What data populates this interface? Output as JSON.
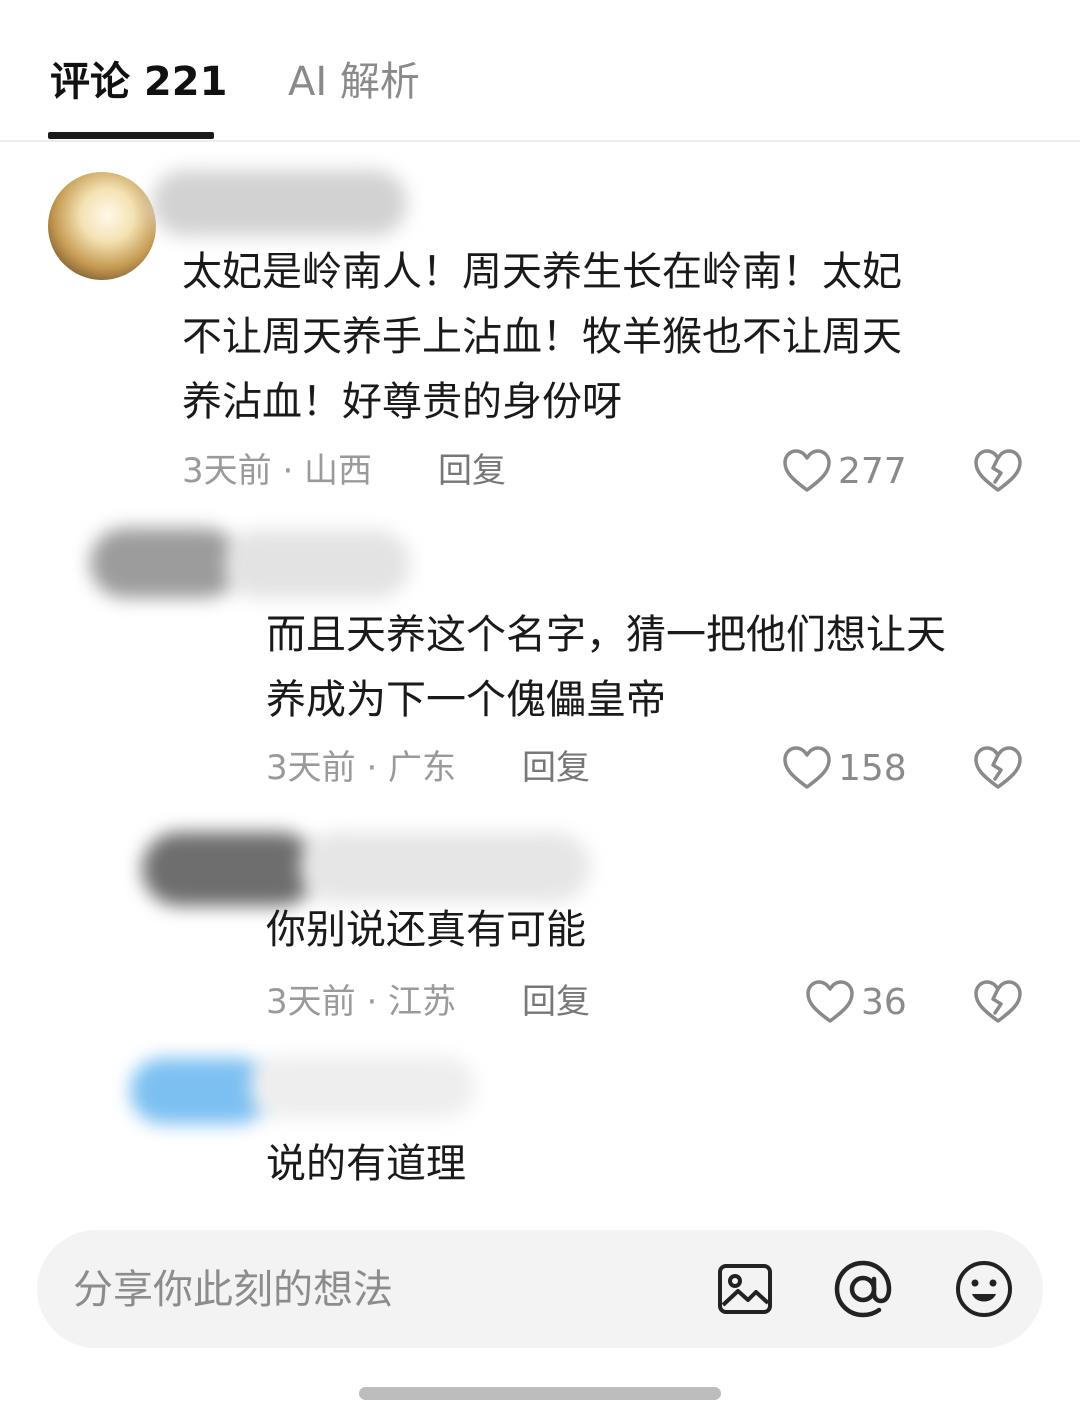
{
  "tabs": [
    {
      "label": "评论 221",
      "active": true
    },
    {
      "label": "AI 解析",
      "active": false
    }
  ],
  "comments": [
    {
      "text_lines": [
        "太妃是岭南人！周天养生长在岭南！太妃",
        "不让周天养手上沾血！牧羊猴也不让周天",
        "养沾血！好尊贵的身份呀"
      ],
      "meta": "3天前 · 山西",
      "reply": "回复",
      "likes": "277"
    },
    {
      "text_lines": [
        "而且天养这个名字，猜一把他们想让天",
        "养成为下一个傀儡皇帝"
      ],
      "meta": "3天前 · 广东",
      "reply": "回复",
      "likes": "158"
    },
    {
      "text_lines": [
        "你别说还真有可能"
      ],
      "meta": "3天前 · 江苏",
      "reply": "回复",
      "likes": "36"
    },
    {
      "text_lines": [
        "说的有道理"
      ]
    }
  ],
  "composer": {
    "placeholder": "分享你此刻的想法"
  },
  "icons": {
    "like": "heart-outline-icon",
    "dislike": "broken-heart-icon",
    "image": "image-icon",
    "mention": "at-icon",
    "emoji": "smiley-icon"
  },
  "colors": {
    "text": "#1a1a1a",
    "muted": "#9a9a9a",
    "composer_bg": "#f3f3f3"
  }
}
